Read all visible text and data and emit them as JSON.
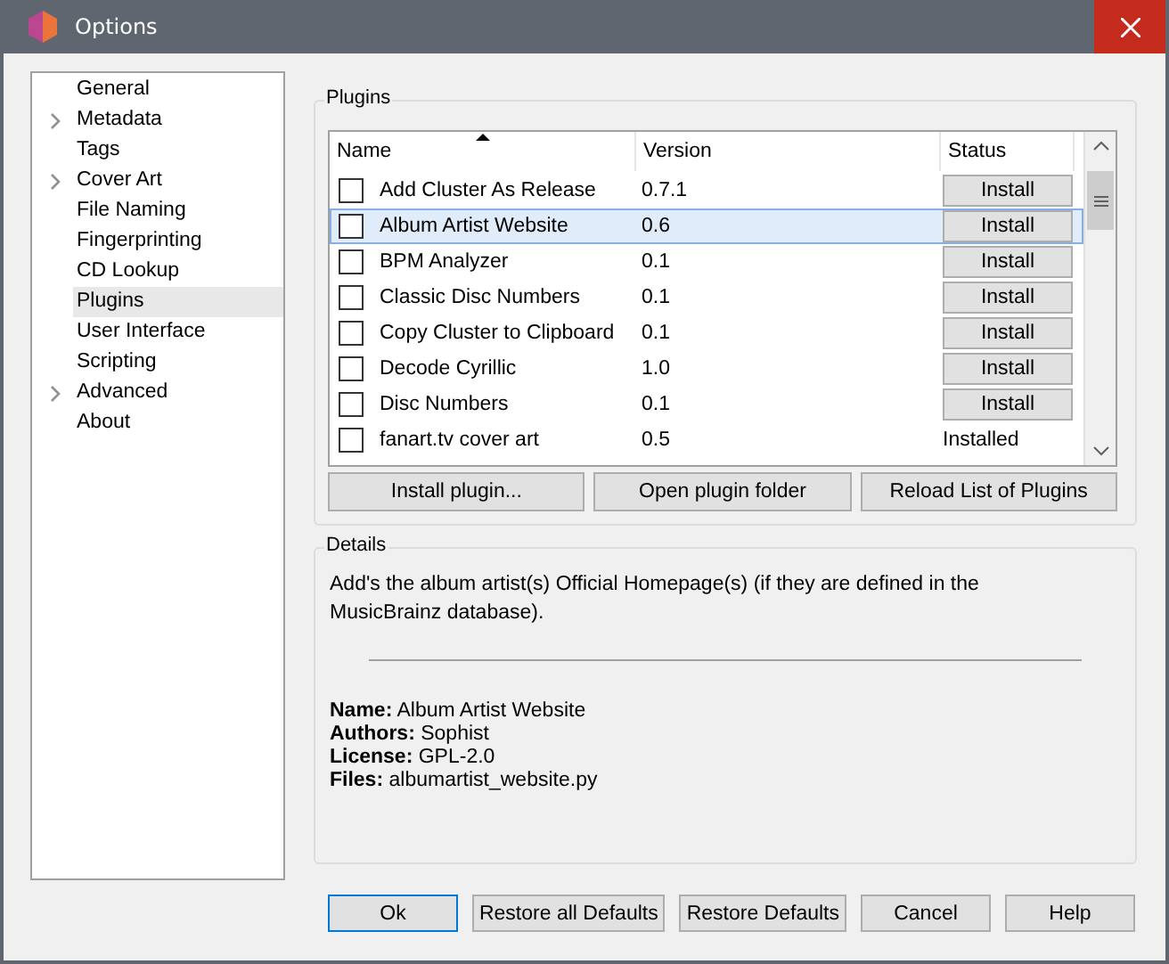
{
  "window": {
    "title": "Options"
  },
  "sidebar": {
    "items": [
      {
        "label": "General",
        "expandable": false,
        "selected": false
      },
      {
        "label": "Metadata",
        "expandable": true,
        "selected": false
      },
      {
        "label": "Tags",
        "expandable": false,
        "selected": false
      },
      {
        "label": "Cover Art",
        "expandable": true,
        "selected": false
      },
      {
        "label": "File Naming",
        "expandable": false,
        "selected": false
      },
      {
        "label": "Fingerprinting",
        "expandable": false,
        "selected": false
      },
      {
        "label": "CD Lookup",
        "expandable": false,
        "selected": false
      },
      {
        "label": "Plugins",
        "expandable": false,
        "selected": true
      },
      {
        "label": "User Interface",
        "expandable": false,
        "selected": false
      },
      {
        "label": "Scripting",
        "expandable": false,
        "selected": false
      },
      {
        "label": "Advanced",
        "expandable": true,
        "selected": false
      },
      {
        "label": "About",
        "expandable": false,
        "selected": false
      }
    ]
  },
  "plugins": {
    "title": "Plugins",
    "columns": [
      {
        "label": "Name",
        "sorted": true
      },
      {
        "label": "Version",
        "sorted": false
      },
      {
        "label": "Status",
        "sorted": false
      }
    ],
    "rows": [
      {
        "name": "Add Cluster As Release",
        "version": "0.7.1",
        "status": {
          "kind": "button",
          "label": "Install"
        },
        "checked": false,
        "selected": false
      },
      {
        "name": "Album Artist Website",
        "version": "0.6",
        "status": {
          "kind": "button",
          "label": "Install"
        },
        "checked": false,
        "selected": true
      },
      {
        "name": "BPM Analyzer",
        "version": "0.1",
        "status": {
          "kind": "button",
          "label": "Install"
        },
        "checked": false,
        "selected": false
      },
      {
        "name": "Classic Disc Numbers",
        "version": "0.1",
        "status": {
          "kind": "button",
          "label": "Install"
        },
        "checked": false,
        "selected": false
      },
      {
        "name": "Copy Cluster to Clipboard",
        "version": "0.1",
        "status": {
          "kind": "button",
          "label": "Install"
        },
        "checked": false,
        "selected": false
      },
      {
        "name": "Decode Cyrillic",
        "version": "1.0",
        "status": {
          "kind": "button",
          "label": "Install"
        },
        "checked": false,
        "selected": false
      },
      {
        "name": "Disc Numbers",
        "version": "0.1",
        "status": {
          "kind": "button",
          "label": "Install"
        },
        "checked": false,
        "selected": false
      },
      {
        "name": "fanart.tv cover art",
        "version": "0.5",
        "status": {
          "kind": "text",
          "label": "Installed"
        },
        "checked": false,
        "selected": false
      }
    ],
    "buttons": [
      "Install plugin...",
      "Open plugin folder",
      "Reload List of Plugins"
    ]
  },
  "details": {
    "title": "Details",
    "description": "Add's the album artist(s) Official Homepage(s) (if they are defined in the MusicBrainz database).",
    "fields": [
      "**Name:** Album Artist Website",
      "**Authors:** Sophist",
      "**License:** GPL-2.0",
      "**Files:** albumartist_website.py"
    ]
  },
  "buttons": [
    {
      "label": "Ok",
      "default": true
    },
    {
      "label": "Restore all Defaults",
      "default": false
    },
    {
      "label": "Restore Defaults",
      "default": false
    },
    {
      "label": "Cancel",
      "default": false
    },
    {
      "label": "Help",
      "default": false
    }
  ]
}
